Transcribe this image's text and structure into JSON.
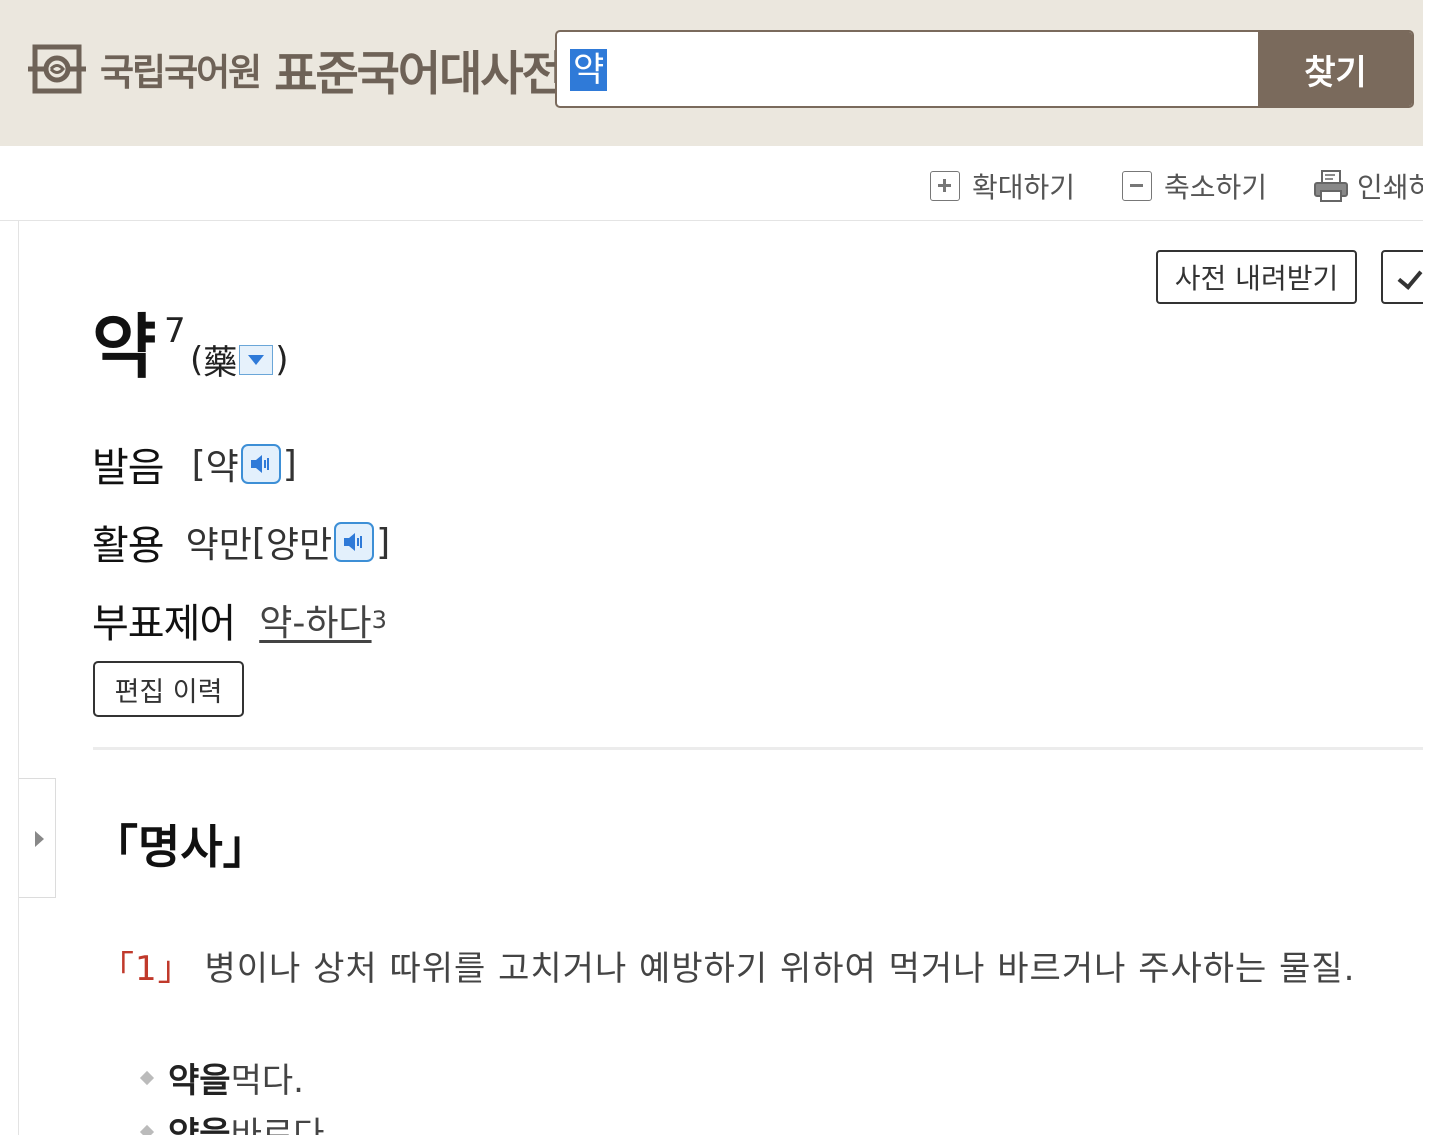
{
  "header": {
    "logo_org": "국립국어원",
    "logo_title": "표준국어대사전",
    "search_value": "약",
    "search_button_label": "찾기"
  },
  "toolbar": {
    "zoom_in_label": "확대하기",
    "zoom_out_label": "축소하기",
    "print_label": "인쇄하기"
  },
  "entry": {
    "download_label": "사전 내려받기",
    "headword": "약",
    "homonym_number": "7",
    "hanja_open": "(",
    "hanja": "藥",
    "hanja_close": ")",
    "pronunciation_label": "발음",
    "pronunciation_open": "[",
    "pronunciation": "약",
    "pronunciation_close": "]",
    "inflection_label": "활용",
    "inflection_form": "약만",
    "inflection_open": "[",
    "inflection_pron": "양만",
    "inflection_close": "]",
    "subentry_label": "부표제어",
    "subentry_word": "약-하다",
    "subentry_sup": "3",
    "history_label": "편집 이력",
    "pos": "「명사」",
    "sense_number": "「1」",
    "sense_text": "병이나 상처 따위를 고치거나 예방하기 위하여 먹거나 바르거나 주사하는 물질.",
    "examples": [
      {
        "keyword": "약을",
        "rest": " 먹다."
      },
      {
        "keyword": "약을",
        "rest": " 바르다."
      }
    ]
  },
  "colors": {
    "header_bg": "#ebe7de",
    "brand_brown": "#7a6a5c",
    "selection_blue": "#2f7ad8",
    "sense_number_red": "#c0392b"
  }
}
